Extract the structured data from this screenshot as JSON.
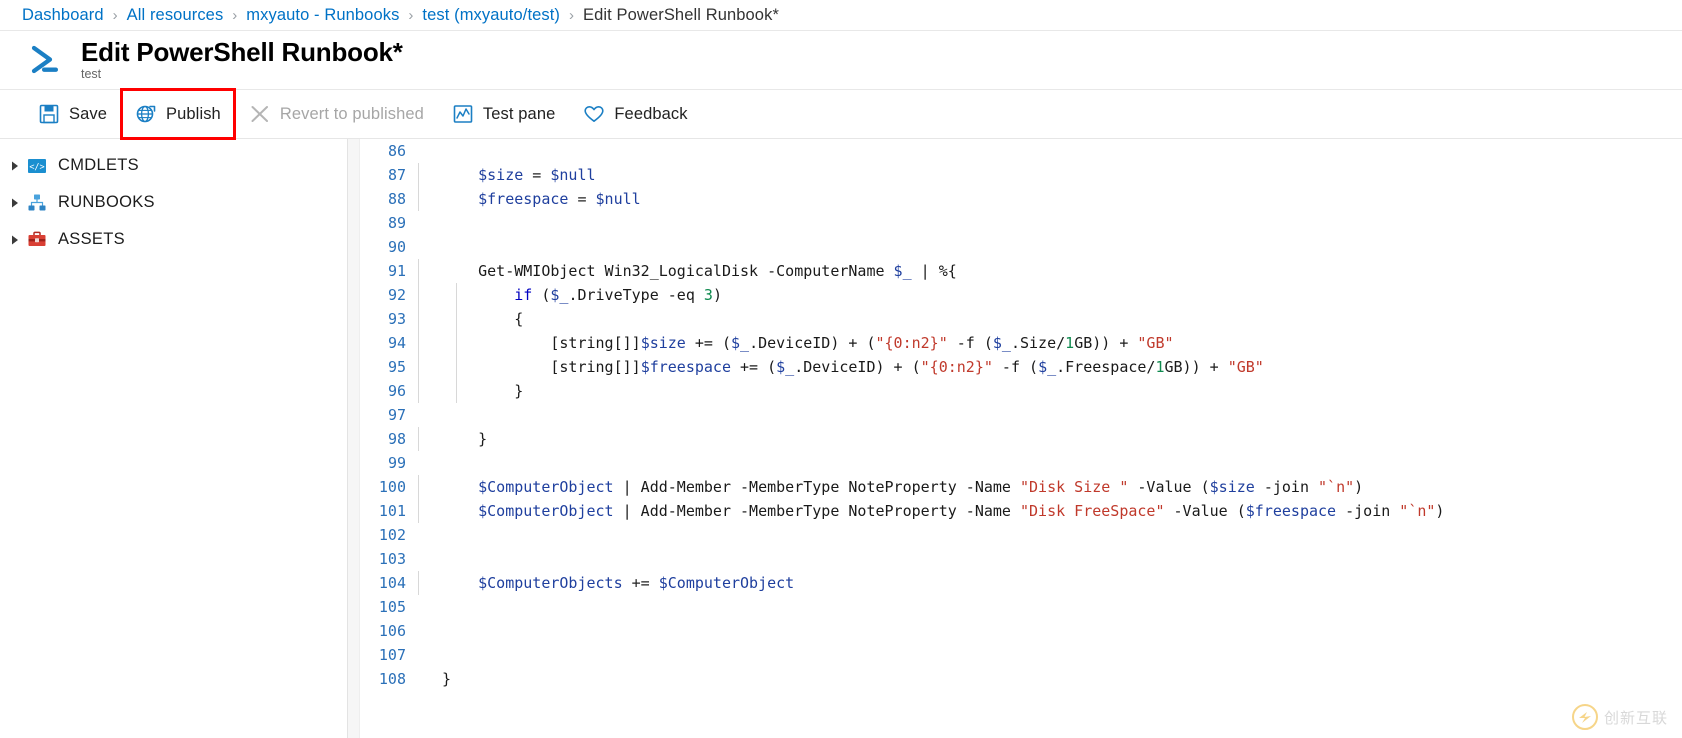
{
  "breadcrumb": {
    "separator": "›",
    "items": [
      {
        "label": "Dashboard",
        "current": false
      },
      {
        "label": "All resources",
        "current": false
      },
      {
        "label": "mxyauto - Runbooks",
        "current": false
      },
      {
        "label": "test (mxyauto/test)",
        "current": false
      },
      {
        "label": "Edit PowerShell Runbook*",
        "current": true
      }
    ]
  },
  "header": {
    "icon": "powershell-icon",
    "title": "Edit PowerShell Runbook*",
    "subtitle": "test"
  },
  "toolbar": {
    "items": [
      {
        "label": "Save",
        "icon": "save-icon",
        "name": "save-button",
        "disabled": false,
        "highlighted": false
      },
      {
        "label": "Publish",
        "icon": "publish-globe-icon",
        "name": "publish-button",
        "disabled": false,
        "highlighted": true
      },
      {
        "label": "Revert to published",
        "icon": "revert-x-icon",
        "name": "revert-to-published-button",
        "disabled": true,
        "highlighted": false
      },
      {
        "label": "Test pane",
        "icon": "test-pane-icon",
        "name": "test-pane-button",
        "disabled": false,
        "highlighted": false
      },
      {
        "label": "Feedback",
        "icon": "heart-icon",
        "name": "feedback-button",
        "disabled": false,
        "highlighted": false
      }
    ],
    "highlight_color": "#ff0000"
  },
  "sidebar": {
    "items": [
      {
        "label": "CMDLETS",
        "icon": "code-brackets-icon",
        "name": "sidebar-item-cmdlets",
        "expanded": false
      },
      {
        "label": "RUNBOOKS",
        "icon": "hierarchy-icon",
        "name": "sidebar-item-runbooks",
        "expanded": false
      },
      {
        "label": "ASSETS",
        "icon": "toolbox-icon",
        "name": "sidebar-item-assets",
        "expanded": false
      }
    ]
  },
  "editor": {
    "language": "powershell",
    "first_line": 86,
    "lines": [
      {
        "n": 86,
        "tokens": []
      },
      {
        "n": 87,
        "tokens": [
          {
            "t": "    ",
            "c": "plain"
          },
          {
            "t": "$size",
            "c": "var"
          },
          {
            "t": " = ",
            "c": "op"
          },
          {
            "t": "$null",
            "c": "var"
          }
        ]
      },
      {
        "n": 88,
        "tokens": [
          {
            "t": "    ",
            "c": "plain"
          },
          {
            "t": "$freespace",
            "c": "var"
          },
          {
            "t": " = ",
            "c": "op"
          },
          {
            "t": "$null",
            "c": "var"
          }
        ]
      },
      {
        "n": 89,
        "tokens": []
      },
      {
        "n": 90,
        "tokens": []
      },
      {
        "n": 91,
        "tokens": [
          {
            "t": "    Get-WMIObject Win32_LogicalDisk -ComputerName ",
            "c": "plain"
          },
          {
            "t": "$_",
            "c": "var"
          },
          {
            "t": " | %{",
            "c": "plain"
          }
        ]
      },
      {
        "n": 92,
        "tokens": [
          {
            "t": "        ",
            "c": "plain"
          },
          {
            "t": "if",
            "c": "kw"
          },
          {
            "t": " (",
            "c": "plain"
          },
          {
            "t": "$_",
            "c": "var"
          },
          {
            "t": ".DriveType -eq ",
            "c": "plain"
          },
          {
            "t": "3",
            "c": "num"
          },
          {
            "t": ")",
            "c": "plain"
          }
        ]
      },
      {
        "n": 93,
        "tokens": [
          {
            "t": "        {",
            "c": "plain"
          }
        ]
      },
      {
        "n": 94,
        "tokens": [
          {
            "t": "            [string[]]",
            "c": "plain"
          },
          {
            "t": "$size",
            "c": "var"
          },
          {
            "t": " += (",
            "c": "plain"
          },
          {
            "t": "$_",
            "c": "var"
          },
          {
            "t": ".DeviceID) + (",
            "c": "plain"
          },
          {
            "t": "\"{0:n2}\"",
            "c": "str"
          },
          {
            "t": " -f (",
            "c": "plain"
          },
          {
            "t": "$_",
            "c": "var"
          },
          {
            "t": ".Size/",
            "c": "plain"
          },
          {
            "t": "1",
            "c": "num"
          },
          {
            "t": "GB)) + ",
            "c": "plain"
          },
          {
            "t": "\"GB\"",
            "c": "str"
          }
        ]
      },
      {
        "n": 95,
        "tokens": [
          {
            "t": "            [string[]]",
            "c": "plain"
          },
          {
            "t": "$freespace",
            "c": "var"
          },
          {
            "t": " += (",
            "c": "plain"
          },
          {
            "t": "$_",
            "c": "var"
          },
          {
            "t": ".DeviceID) + (",
            "c": "plain"
          },
          {
            "t": "\"{0:n2}\"",
            "c": "str"
          },
          {
            "t": " -f (",
            "c": "plain"
          },
          {
            "t": "$_",
            "c": "var"
          },
          {
            "t": ".Freespace/",
            "c": "plain"
          },
          {
            "t": "1",
            "c": "num"
          },
          {
            "t": "GB)) + ",
            "c": "plain"
          },
          {
            "t": "\"GB\"",
            "c": "str"
          }
        ]
      },
      {
        "n": 96,
        "tokens": [
          {
            "t": "        }",
            "c": "plain"
          }
        ]
      },
      {
        "n": 97,
        "tokens": []
      },
      {
        "n": 98,
        "tokens": [
          {
            "t": "    }",
            "c": "plain"
          }
        ]
      },
      {
        "n": 99,
        "tokens": []
      },
      {
        "n": 100,
        "tokens": [
          {
            "t": "    ",
            "c": "plain"
          },
          {
            "t": "$ComputerObject",
            "c": "var"
          },
          {
            "t": " | Add-Member -MemberType NoteProperty -Name ",
            "c": "plain"
          },
          {
            "t": "\"Disk Size \"",
            "c": "str"
          },
          {
            "t": " -Value (",
            "c": "plain"
          },
          {
            "t": "$size",
            "c": "var"
          },
          {
            "t": " -join ",
            "c": "plain"
          },
          {
            "t": "\"`n\"",
            "c": "str"
          },
          {
            "t": ")",
            "c": "plain"
          }
        ]
      },
      {
        "n": 101,
        "tokens": [
          {
            "t": "    ",
            "c": "plain"
          },
          {
            "t": "$ComputerObject",
            "c": "var"
          },
          {
            "t": " | Add-Member -MemberType NoteProperty -Name ",
            "c": "plain"
          },
          {
            "t": "\"Disk FreeSpace\"",
            "c": "str"
          },
          {
            "t": " -Value (",
            "c": "plain"
          },
          {
            "t": "$freespace",
            "c": "var"
          },
          {
            "t": " -join ",
            "c": "plain"
          },
          {
            "t": "\"`n\"",
            "c": "str"
          },
          {
            "t": ")",
            "c": "plain"
          }
        ]
      },
      {
        "n": 102,
        "tokens": []
      },
      {
        "n": 103,
        "tokens": []
      },
      {
        "n": 104,
        "tokens": [
          {
            "t": "    ",
            "c": "plain"
          },
          {
            "t": "$ComputerObjects",
            "c": "var"
          },
          {
            "t": " += ",
            "c": "op"
          },
          {
            "t": "$ComputerObject",
            "c": "var"
          }
        ]
      },
      {
        "n": 105,
        "tokens": []
      },
      {
        "n": 106,
        "tokens": []
      },
      {
        "n": 107,
        "tokens": []
      },
      {
        "n": 108,
        "tokens": [
          {
            "t": "}",
            "c": "plain"
          }
        ]
      }
    ]
  },
  "watermark": {
    "text": "创新互联"
  }
}
